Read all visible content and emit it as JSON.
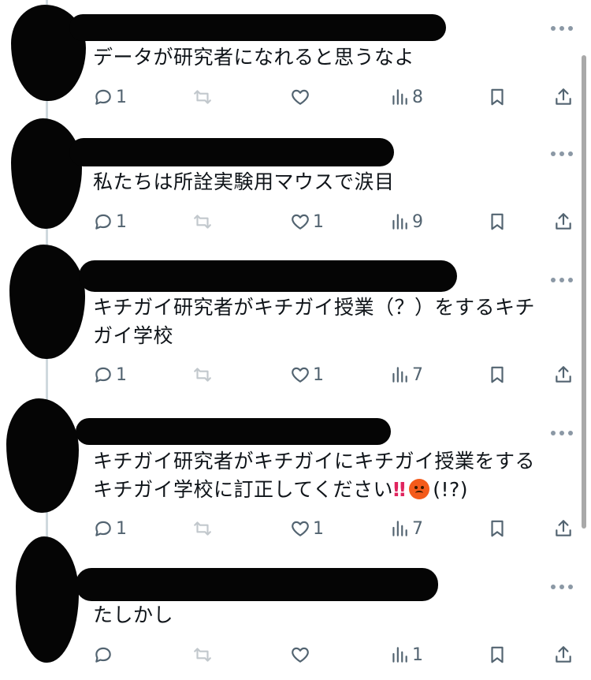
{
  "tweets": [
    {
      "text": "データが研究者になれると思うなよ",
      "reply_count": "1",
      "retweet_count": "",
      "like_count": "",
      "view_count": "8"
    },
    {
      "text": "私たちは所詮実験用マウスで涙目",
      "reply_count": "1",
      "retweet_count": "",
      "like_count": "1",
      "view_count": "9"
    },
    {
      "text": "キチガイ研究者がキチガイ授業（？）をするキチガイ学校",
      "reply_count": "1",
      "retweet_count": "",
      "like_count": "1",
      "view_count": "7"
    },
    {
      "text_line1": "キチガイ研究者がキチガイにキチガイ授業をする",
      "text_line2": "キチガイ学校に訂正してください",
      "text_bangs": "‼",
      "text_suffix": "(!?)",
      "emoji": "angry-face",
      "reply_count": "1",
      "retweet_count": "",
      "like_count": "1",
      "view_count": "7"
    },
    {
      "text": "たしかし",
      "reply_count": "",
      "retweet_count": "",
      "like_count": "",
      "view_count": "1"
    }
  ],
  "icons": {
    "more": "more-horizontal-icon",
    "reply": "reply-icon",
    "retweet": "retweet-icon",
    "like": "heart-icon",
    "views": "analytics-icon",
    "bookmark": "bookmark-icon",
    "share": "share-icon"
  },
  "colors": {
    "text": "#0f1419",
    "secondary": "#536471",
    "thread_line": "#cfd9de",
    "redaction": "#050505"
  }
}
